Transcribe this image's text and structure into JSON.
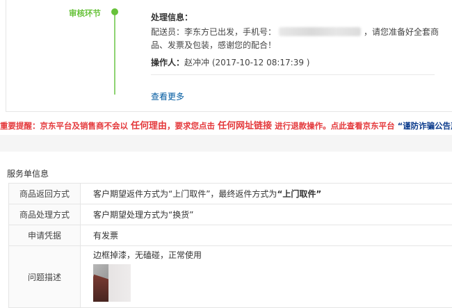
{
  "audit": {
    "stage_label": "审核环节",
    "info_title": "处理信息：",
    "line1_before": "配送员：李东方已出发，手机号：",
    "line1_after": "，请您准备好全套商",
    "line2": "品、发票及包装，感谢您的配合！",
    "operator_label": "操作人：",
    "operator_value": "赵冲冲 (2017-10-12 08:17:39 )",
    "see_more": "查看更多",
    "accent_color": "#67c23a"
  },
  "warning": {
    "label": "重要提醒：",
    "t1": "京东平台及销售商不会以",
    "e1": "任何理由",
    "t2": "，要求您点击",
    "e2": "任何网址链接",
    "t3": "进行退款操作。点此查看京东平台",
    "link": "“谨防诈骗公告声明”"
  },
  "service": {
    "title": "服务单信息",
    "rows": [
      {
        "key": "商品返回方式",
        "val_pre": "客户期望返件方式为“上门取件”，最终返件方式为",
        "val_bold": "“上门取件”"
      },
      {
        "key": "商品处理方式",
        "val_pre": "客户期望处理方式为“换货”",
        "val_bold": ""
      },
      {
        "key": "申请凭据",
        "val_pre": "有发票",
        "val_bold": ""
      },
      {
        "key": "问题描述",
        "val_pre": "边框掉漆，无磕碰，正常使用",
        "val_bold": ""
      }
    ]
  }
}
